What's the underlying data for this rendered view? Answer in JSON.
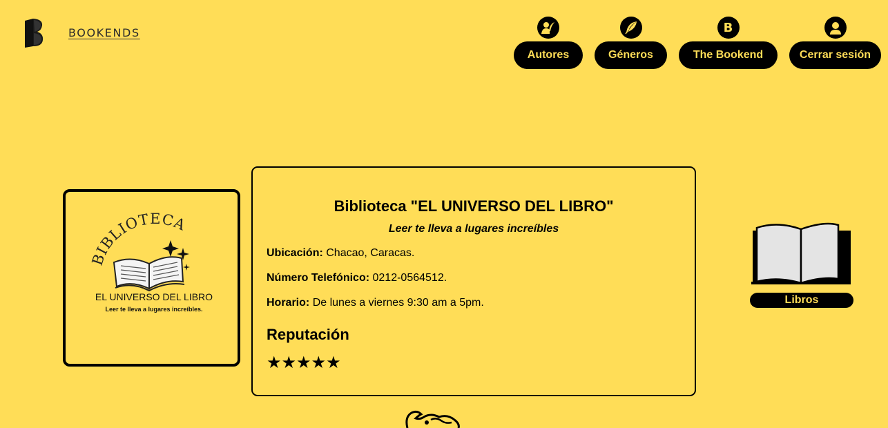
{
  "header": {
    "brand_name": "BOOKENDS",
    "nav": [
      {
        "label": "Autores",
        "icon": "author-quill-icon"
      },
      {
        "label": "Géneros",
        "icon": "feather-icon"
      },
      {
        "label": "The Bookend",
        "icon": "bookends-b-icon"
      },
      {
        "label": "Cerrar sesión",
        "icon": "user-icon"
      }
    ]
  },
  "library": {
    "logo_text": {
      "arc": "BIBLIOTECA",
      "name": "EL UNIVERSO DEL LIBRO",
      "tagline": "Leer te lleva a lugares increíbles."
    },
    "title": "Biblioteca \"EL UNIVERSO DEL LIBRO\"",
    "slogan": "Leer te lleva a lugares increíbles",
    "location_label": "Ubicación:",
    "location_value": "Chacao, Caracas.",
    "phone_label": "Número Telefónico:",
    "phone_value": "0212-0564512.",
    "hours_label": "Horario:",
    "hours_value": "De lunes a viernes 9:30 am a 5pm.",
    "reputation_heading": "Reputación",
    "reputation_stars": "★★★★★",
    "rating": 5
  },
  "books_widget": {
    "label": "Libros",
    "icon": "open-book-icon"
  },
  "colors": {
    "background": "#ffdd57",
    "button": "#000000",
    "button_text": "#ffdd57"
  }
}
